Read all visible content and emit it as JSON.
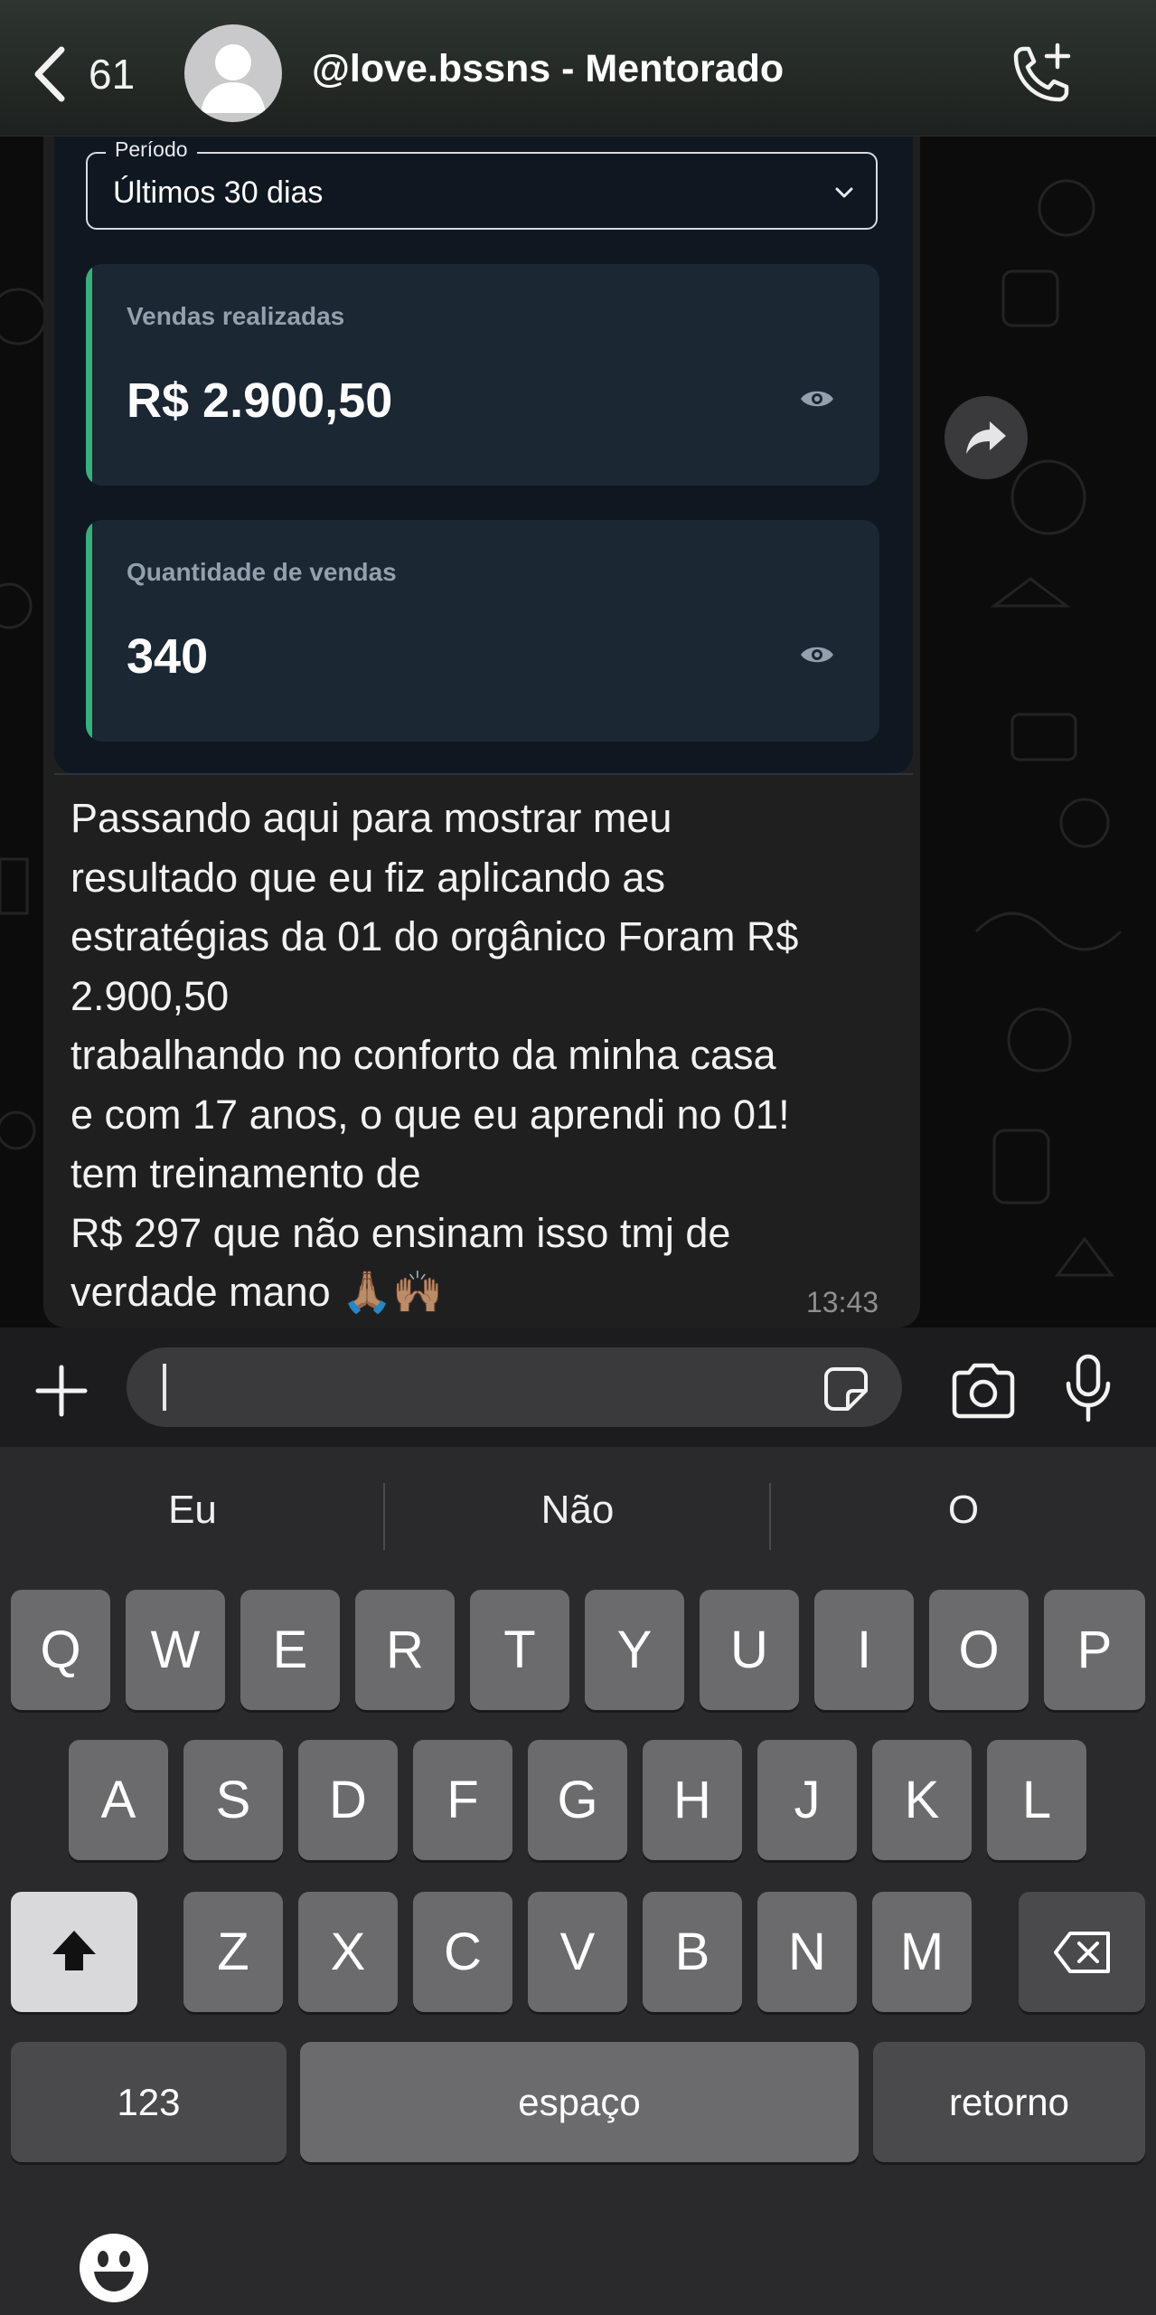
{
  "header": {
    "back_count": "61",
    "title": "@love.bssns - Mentorado"
  },
  "screenshot": {
    "period_label": "Período",
    "period_value": "Últimos 30 dias",
    "cards": [
      {
        "label": "Vendas realizadas",
        "value": "R$ 2.900,50"
      },
      {
        "label": "Quantidade de vendas",
        "value": "340"
      }
    ]
  },
  "message": {
    "text": "Passando aqui para mostrar meu\nresultado que eu fiz aplicando as\nestratégias da 01 do orgânico Foram R$\n2.900,50\ntrabalhando no conforto da minha casa\ne com 17 anos, o que eu aprendi no 01!\ntem treinamento de\nR$ 297 que não ensinam isso tmj de\nverdade mano 🙏🏽🙌🏽",
    "time": "13:43"
  },
  "input": {
    "value": ""
  },
  "keyboard": {
    "suggestions": [
      "Eu",
      "Não",
      "O"
    ],
    "row1": [
      "Q",
      "W",
      "E",
      "R",
      "T",
      "Y",
      "U",
      "I",
      "O",
      "P"
    ],
    "row2": [
      "A",
      "S",
      "D",
      "F",
      "G",
      "H",
      "J",
      "K",
      "L"
    ],
    "row3": [
      "Z",
      "X",
      "C",
      "V",
      "B",
      "N",
      "M"
    ],
    "numbers_label": "123",
    "space_label": "espaço",
    "return_label": "retorno"
  }
}
